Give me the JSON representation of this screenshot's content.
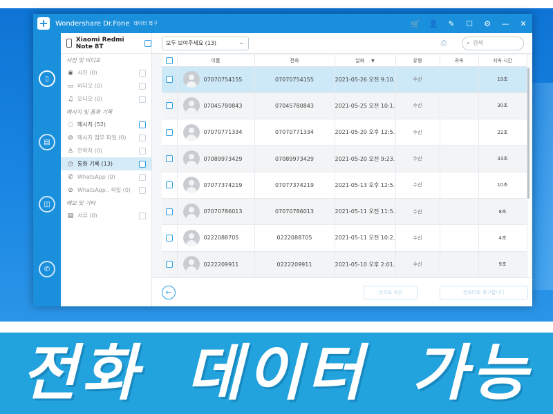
{
  "window": {
    "app_title": "Wondershare Dr.Fone",
    "app_subtitle": "데이터 복구",
    "title_icons": [
      "cart-icon",
      "user-icon",
      "feedback-icon",
      "chat-icon",
      "settings-icon",
      "minimize-icon",
      "close-icon"
    ],
    "accent_color": "#1a8fdc"
  },
  "rail": {
    "items": [
      "phone-recovery-icon",
      "broken-phone-icon",
      "backup-icon",
      "whatsapp-icon"
    ]
  },
  "device": {
    "name": "Xiaomi Redmi Note 8T"
  },
  "categories": [
    {
      "group": "사진 및 비디오",
      "items": [
        {
          "icon": "camera-icon",
          "label": "사진 (0)"
        },
        {
          "icon": "video-icon",
          "label": "비디오 (0)"
        },
        {
          "icon": "music-icon",
          "label": "오디오 (0)"
        }
      ]
    },
    {
      "group": "메시지 및 통화 기록",
      "items": [
        {
          "icon": "message-icon",
          "label": "메시지 (52)"
        },
        {
          "icon": "attachment-icon",
          "label": "메시지 첨부 파일 (0)"
        },
        {
          "icon": "contacts-icon",
          "label": "연락처 (0)"
        },
        {
          "icon": "clock-icon",
          "label": "통화 기록 (13)"
        },
        {
          "icon": "whatsapp-icon",
          "label": "WhatsApp (0)"
        },
        {
          "icon": "attachment-icon",
          "label": "WhatsApp.. 파일 (0)"
        }
      ]
    },
    {
      "group": "메모 및 기타",
      "items": [
        {
          "icon": "document-icon",
          "label": "서류 (0)"
        }
      ]
    }
  ],
  "toolbar": {
    "filter_value": "모두 보여주세요 (13)",
    "search_placeholder": "검색"
  },
  "table": {
    "columns": [
      "이름",
      "전화",
      "날짜",
      "유형",
      "귀속",
      "지속 시간"
    ],
    "rows": [
      {
        "name": "07070754155",
        "phone": "07070754155",
        "date": "2021-05-26 오전 9:10...",
        "type": "수신",
        "dest": "",
        "duration": "19초"
      },
      {
        "name": "07045780843",
        "phone": "07045780843",
        "date": "2021-05-25 오전 10:1...",
        "type": "수신",
        "dest": "",
        "duration": "30초"
      },
      {
        "name": "07070771334",
        "phone": "07070771334",
        "date": "2021-05-20 오후 12:5...",
        "type": "수신",
        "dest": "",
        "duration": "22초"
      },
      {
        "name": "07089973429",
        "phone": "07089973429",
        "date": "2021-05-20 오전 9:23...",
        "type": "수신",
        "dest": "",
        "duration": "33초"
      },
      {
        "name": "07077374219",
        "phone": "07077374219",
        "date": "2021-05-13 오후 12:5...",
        "type": "수신",
        "dest": "",
        "duration": "10초"
      },
      {
        "name": "07070786013",
        "phone": "07070786013",
        "date": "2021-05-11 오전 11:5...",
        "type": "수신",
        "dest": "",
        "duration": "8초"
      },
      {
        "name": "0222088705",
        "phone": "0222088705",
        "date": "2021-05-11 오전 10:2...",
        "type": "수신",
        "dest": "",
        "duration": "4초"
      },
      {
        "name": "0222209911",
        "phone": "0222209911",
        "date": "2021-05-10 오후 2:01...",
        "type": "수신",
        "dest": "",
        "duration": "9초"
      }
    ]
  },
  "footer": {
    "btn1_label": "장치로 복원",
    "btn2_label": "컴퓨터로 복구합니다"
  },
  "banner": {
    "text": "전화 데이터 가능",
    "color": "#22a3dd"
  }
}
